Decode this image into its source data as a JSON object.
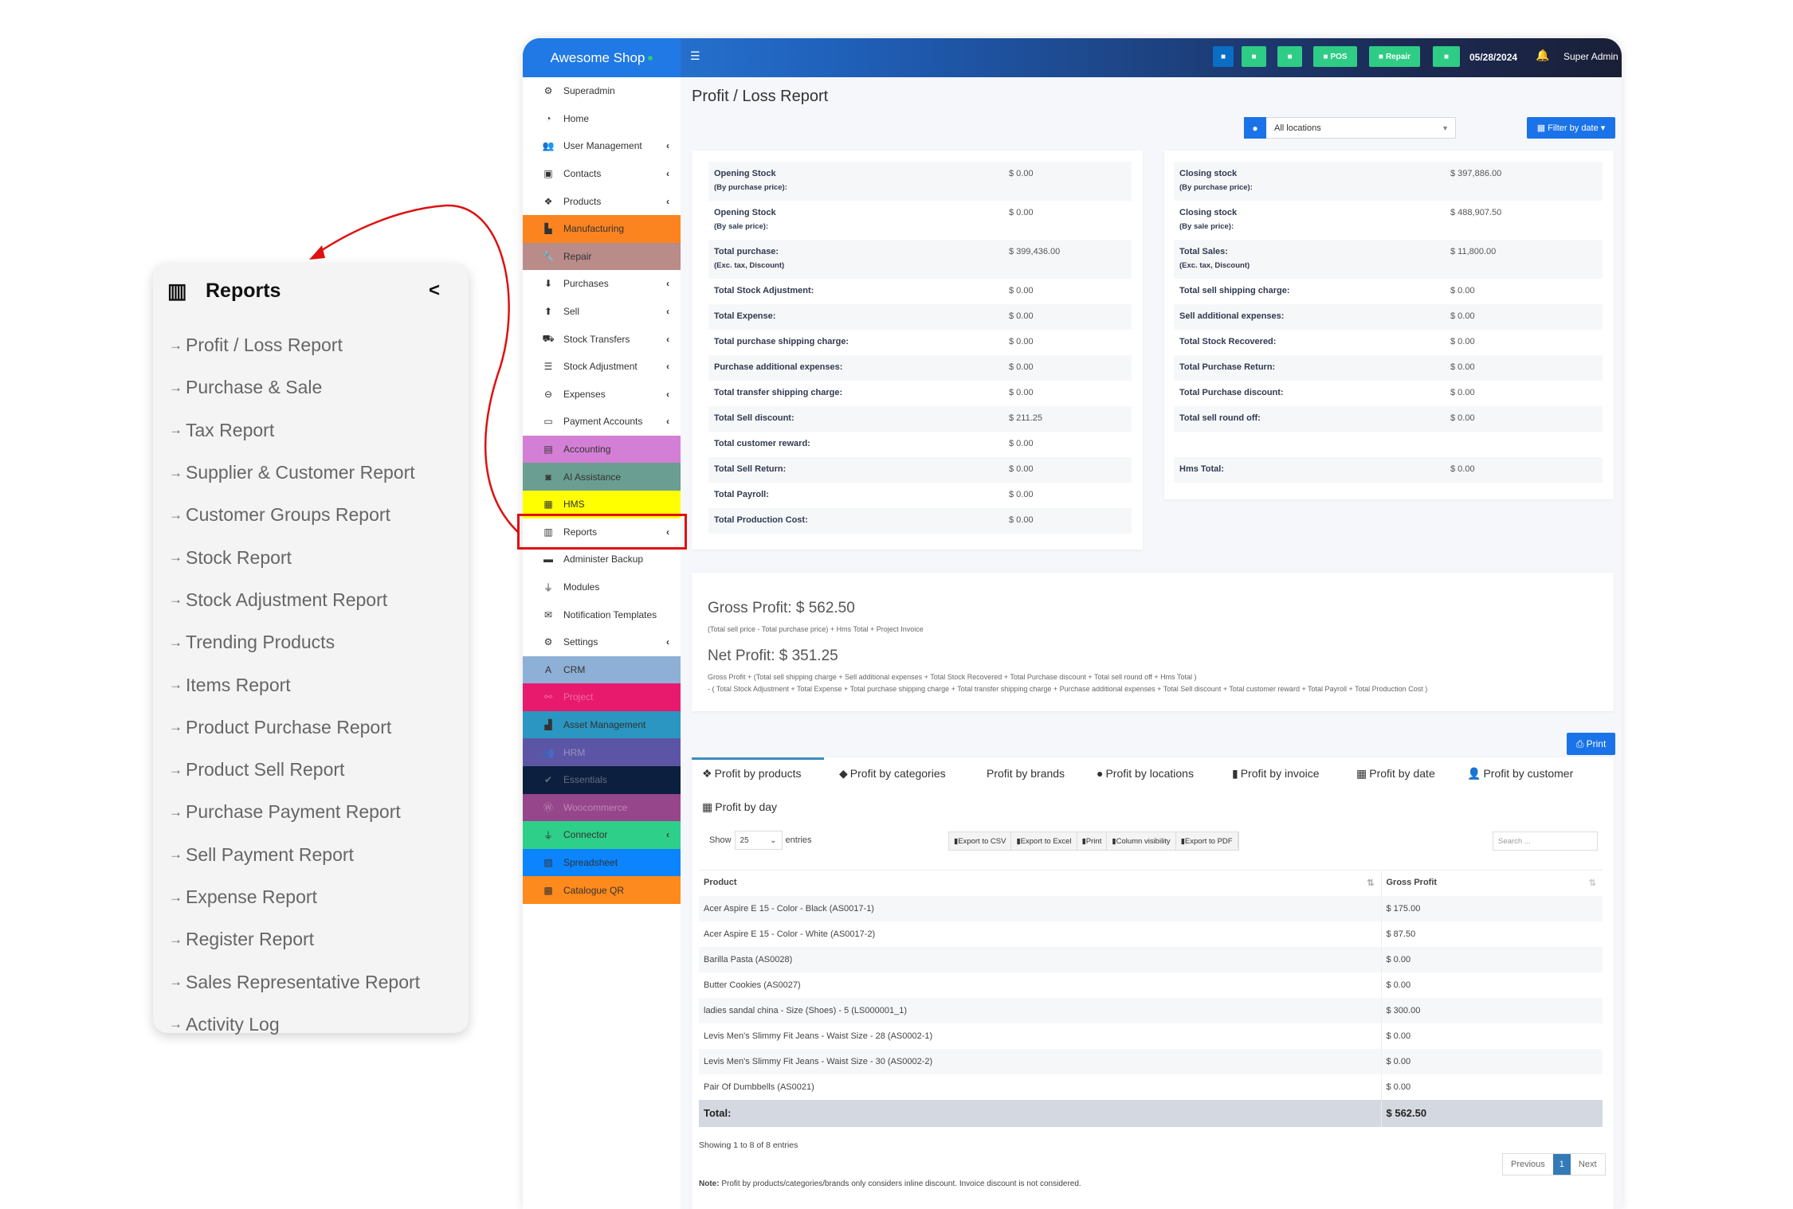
{
  "callout": {
    "title": "Reports",
    "icon": "bar-chart-icon",
    "items": [
      "Profit / Loss Report",
      "Purchase & Sale",
      "Tax Report",
      "Supplier & Customer Report",
      "Customer Groups Report",
      "Stock Report",
      "Stock Adjustment Report",
      "Trending Products",
      "Items Report",
      "Product Purchase Report",
      "Product Sell Report",
      "Purchase Payment Report",
      "Sell Payment Report",
      "Expense Report",
      "Register Report",
      "Sales Representative Report",
      "Activity Log"
    ]
  },
  "header": {
    "brand": "Awesome Shop",
    "buttons": [
      {
        "icon": "download-icon",
        "label": "",
        "color": "#0a6ec4"
      },
      {
        "icon": "plus-circle-icon",
        "label": "",
        "color": "#2ecc85"
      },
      {
        "icon": "calculator-icon",
        "label": "",
        "color": "#2ecc85"
      },
      {
        "icon": "pos-icon",
        "label": "POS",
        "color": "#2ecc85"
      },
      {
        "icon": "wrench-icon",
        "label": "Repair",
        "color": "#2ecc85"
      },
      {
        "icon": "money-icon",
        "label": "",
        "color": "#2ecc85"
      }
    ],
    "date": "05/28/2024",
    "user": "Super Admin"
  },
  "sidebar": {
    "items": [
      {
        "label": "Superadmin",
        "icon": "users-cog-icon",
        "glyph": "⚙"
      },
      {
        "label": "Home",
        "icon": "dashboard-icon",
        "glyph": "◔"
      },
      {
        "label": "User Management",
        "icon": "users-icon",
        "glyph": "👥",
        "sub": true
      },
      {
        "label": "Contacts",
        "icon": "address-book-icon",
        "glyph": "▣",
        "sub": true
      },
      {
        "label": "Products",
        "icon": "cubes-icon",
        "glyph": "❖",
        "sub": true
      },
      {
        "label": "Manufacturing",
        "icon": "industry-icon",
        "glyph": "▙",
        "bg": "#fb8420"
      },
      {
        "label": "Repair",
        "icon": "wrench-icon",
        "glyph": "🔧",
        "bg": "#b98b89"
      },
      {
        "label": "Purchases",
        "icon": "arrow-circle-down-icon",
        "glyph": "⬇",
        "sub": true
      },
      {
        "label": "Sell",
        "icon": "arrow-circle-up-icon",
        "glyph": "⬆",
        "sub": true
      },
      {
        "label": "Stock Transfers",
        "icon": "truck-icon",
        "glyph": "⛟",
        "sub": true
      },
      {
        "label": "Stock Adjustment",
        "icon": "database-icon",
        "glyph": "☰",
        "sub": true
      },
      {
        "label": "Expenses",
        "icon": "minus-circle-icon",
        "glyph": "⊖",
        "sub": true
      },
      {
        "label": "Payment Accounts",
        "icon": "money-check-icon",
        "glyph": "▭",
        "sub": true
      },
      {
        "label": "Accounting",
        "icon": "credit-card-icon",
        "glyph": "▤",
        "bg": "#d47fd6"
      },
      {
        "label": "AI Assistance",
        "icon": "robot-icon",
        "glyph": "◙",
        "bg": "#6a9e92"
      },
      {
        "label": "HMS",
        "icon": "hotel-icon",
        "glyph": "▦",
        "bg": "#ffff00"
      },
      {
        "label": "Reports",
        "icon": "bar-chart-icon",
        "glyph": "▥",
        "sub": true
      },
      {
        "label": "Administer Backup",
        "icon": "hdd-icon",
        "glyph": "▬"
      },
      {
        "label": "Modules",
        "icon": "plug-icon",
        "glyph": "⏚"
      },
      {
        "label": "Notification Templates",
        "icon": "envelope-icon",
        "glyph": "✉"
      },
      {
        "label": "Settings",
        "icon": "cog-icon",
        "glyph": "⚙",
        "sub": true
      },
      {
        "label": "CRM",
        "icon": "broadcast-icon",
        "glyph": "A",
        "bg": "#8eb0d6"
      },
      {
        "label": "Project",
        "icon": "project-diagram-icon",
        "glyph": "⚯",
        "bg": "#e81a6e"
      },
      {
        "label": "Asset Management",
        "icon": "boxes-icon",
        "glyph": "▟",
        "bg": "#2a96c1"
      },
      {
        "label": "HRM",
        "icon": "users-icon",
        "glyph": "👥",
        "bg": "#5c55a6"
      },
      {
        "label": "Essentials",
        "icon": "check-circle-icon",
        "glyph": "✔",
        "bg": "#0c1f3e"
      },
      {
        "label": "Woocommerce",
        "icon": "wordpress-icon",
        "glyph": "Ⓦ",
        "bg": "#96468b"
      },
      {
        "label": "Connector",
        "icon": "plug-icon",
        "glyph": "⏚",
        "bg": "#2ecf88",
        "sub": true
      },
      {
        "label": "Spreadsheet",
        "icon": "file-excel-icon",
        "glyph": "▧",
        "bg": "#0b84fe"
      },
      {
        "label": "Catalogue QR",
        "icon": "qrcode-icon",
        "glyph": "▩",
        "bg": "#fd8a1d"
      }
    ]
  },
  "main": {
    "title": "Profit / Loss Report",
    "location": "All locations",
    "filter_label": "Filter by date",
    "left_rows": [
      {
        "label": "Opening Stock",
        "sub": "(By purchase price):",
        "value": "$ 0.00"
      },
      {
        "label": "Opening Stock",
        "sub": "(By sale price):",
        "value": "$ 0.00"
      },
      {
        "label": "Total purchase:",
        "sub": "(Exc. tax, Discount)",
        "value": "$ 399,436.00"
      },
      {
        "label": "Total Stock Adjustment:",
        "value": "$ 0.00"
      },
      {
        "label": "Total Expense:",
        "value": "$ 0.00"
      },
      {
        "label": "Total purchase shipping charge:",
        "value": "$ 0.00"
      },
      {
        "label": "Purchase additional expenses:",
        "value": "$ 0.00"
      },
      {
        "label": "Total transfer shipping charge:",
        "value": "$ 0.00"
      },
      {
        "label": "Total Sell discount:",
        "value": "$ 211.25"
      },
      {
        "label": "Total customer reward:",
        "value": "$ 0.00"
      },
      {
        "label": "Total Sell Return:",
        "value": "$ 0.00"
      },
      {
        "label": "Total Payroll:",
        "value": "$ 0.00"
      },
      {
        "label": "Total Production Cost:",
        "value": "$ 0.00"
      }
    ],
    "right_rows": [
      {
        "label": "Closing stock",
        "sub": "(By purchase price):",
        "value": "$ 397,886.00"
      },
      {
        "label": "Closing stock",
        "sub": "(By sale price):",
        "value": "$ 488,907.50"
      },
      {
        "label": "Total Sales:",
        "sub": "(Exc. tax, Discount)",
        "value": "$ 11,800.00"
      },
      {
        "label": "Total sell shipping charge:",
        "value": "$ 0.00"
      },
      {
        "label": "Sell additional expenses:",
        "value": "$ 0.00"
      },
      {
        "label": "Total Stock Recovered:",
        "value": "$ 0.00"
      },
      {
        "label": "Total Purchase Return:",
        "value": "$ 0.00"
      },
      {
        "label": "Total Purchase discount:",
        "value": "$ 0.00"
      },
      {
        "label": "Total sell round off:",
        "value": "$ 0.00"
      },
      {
        "label": "",
        "value": ""
      },
      {
        "label": "Hms Total:",
        "value": "$ 0.00"
      }
    ],
    "gross_profit": "Gross Profit: $ 562.50",
    "gross_formula": "(Total sell price - Total purchase price) + Hms Total + Project Invoice",
    "net_profit": "Net Profit: $ 351.25",
    "net_formula_1": "Gross Profit + (Total sell shipping charge + Sell additional expenses + Total Stock Recovered + Total Purchase discount + Total sell round off + Hms Total )",
    "net_formula_2": "- ( Total Stock Adjustment + Total Expense + Total purchase shipping charge + Total transfer shipping charge + Purchase additional expenses + Total Sell discount + Total customer reward + Total Payroll + Total Production Cost )",
    "print_label": "Print",
    "tabs": [
      {
        "label": "Profit by products",
        "icon": "cubes-icon",
        "glyph": "❖",
        "active": true
      },
      {
        "label": "Profit by categories",
        "icon": "tags-icon",
        "glyph": "◆"
      },
      {
        "label": "Profit by brands",
        "icon": "",
        "glyph": ""
      },
      {
        "label": "Profit by locations",
        "icon": "map-marker-icon",
        "glyph": "●"
      },
      {
        "label": "Profit by invoice",
        "icon": "file-icon",
        "glyph": "▮"
      },
      {
        "label": "Profit by date",
        "icon": "calendar-icon",
        "glyph": "▦"
      },
      {
        "label": "Profit by customer",
        "icon": "user-icon",
        "glyph": "👤"
      },
      {
        "label": "Profit by day",
        "icon": "calendar-icon",
        "glyph": "▦"
      }
    ],
    "show_label": "Show",
    "entries_value": "25",
    "entries_label": "entries",
    "export_buttons": [
      "Export to CSV",
      "Export to Excel",
      "Print",
      "Column visibility",
      "Export to PDF"
    ],
    "search_placeholder": "Search ...",
    "table": {
      "columns": [
        "Product",
        "Gross Profit"
      ],
      "rows": [
        [
          "Acer Aspire E 15 - Color - Black (AS0017-1)",
          "$ 175.00"
        ],
        [
          "Acer Aspire E 15 - Color - White (AS0017-2)",
          "$ 87.50"
        ],
        [
          "Barilla Pasta (AS0028)",
          "$ 0.00"
        ],
        [
          "Butter Cookies (AS0027)",
          "$ 0.00"
        ],
        [
          "ladies sandal china - Size (Shoes) - 5 (LS000001_1)",
          "$ 300.00"
        ],
        [
          "Levis Men's Slimmy Fit Jeans - Waist Size - 28 (AS0002-1)",
          "$ 0.00"
        ],
        [
          "Levis Men's Slimmy Fit Jeans - Waist Size - 30 (AS0002-2)",
          "$ 0.00"
        ],
        [
          "Pair Of Dumbbells (AS0021)",
          "$ 0.00"
        ]
      ],
      "total_label": "Total:",
      "total_value": "$ 562.50"
    },
    "showing": "Showing 1 to 8 of 8 entries",
    "pager": {
      "prev": "Previous",
      "page": "1",
      "next": "Next"
    },
    "note_label": "Note:",
    "note": " Profit by products/categories/brands only considers inline discount. Invoice discount is not considered."
  }
}
